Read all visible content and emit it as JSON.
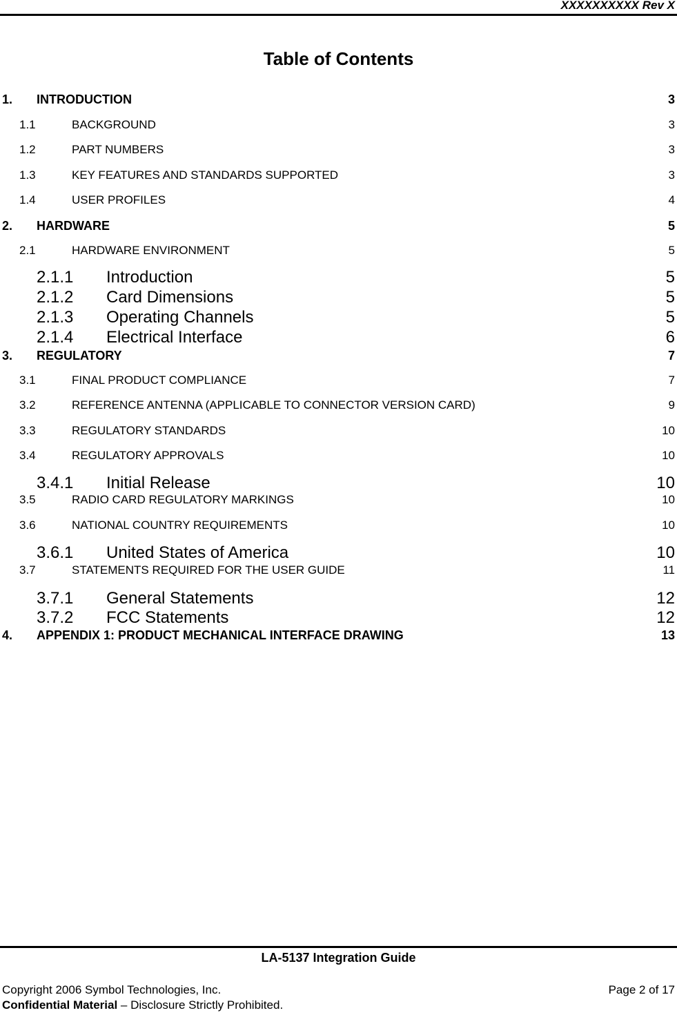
{
  "header": {
    "doc_id": "XXXXXXXXXX Rev X"
  },
  "title": "Table of Contents",
  "toc": [
    {
      "level": 1,
      "num": "1.",
      "label": "INTRODUCTION",
      "page": "3"
    },
    {
      "level": 2,
      "num": "1.1",
      "label": "BACKGROUND",
      "page": "3"
    },
    {
      "level": 2,
      "num": "1.2",
      "label": "PART NUMBERS",
      "page": "3"
    },
    {
      "level": 2,
      "num": "1.3",
      "label": "KEY FEATURES AND STANDARDS SUPPORTED",
      "page": "3"
    },
    {
      "level": 2,
      "num": "1.4",
      "label": "USER PROFILES",
      "page": "4"
    },
    {
      "level": 1,
      "num": "2.",
      "label": "HARDWARE",
      "page": "5"
    },
    {
      "level": 2,
      "num": "2.1",
      "label": "HARDWARE ENVIRONMENT",
      "page": "5"
    },
    {
      "level": 3,
      "num": "2.1.1",
      "label": "Introduction",
      "page": "5"
    },
    {
      "level": 3,
      "num": "2.1.2",
      "label": "Card Dimensions",
      "page": "5"
    },
    {
      "level": 3,
      "num": "2.1.3",
      "label": "Operating Channels",
      "page": "5"
    },
    {
      "level": 3,
      "num": "2.1.4",
      "label": "Electrical Interface",
      "page": "6"
    },
    {
      "level": 1,
      "num": "3.",
      "label": "REGULATORY",
      "page": "7"
    },
    {
      "level": 2,
      "num": "3.1",
      "label": "FINAL PRODUCT COMPLIANCE",
      "page": "7"
    },
    {
      "level": 2,
      "num": "3.2",
      "label": "REFERENCE ANTENNA (APPLICABLE TO CONNECTOR VERSION CARD)",
      "page": "9"
    },
    {
      "level": 2,
      "num": "3.3",
      "label": "REGULATORY STANDARDS",
      "page": "10"
    },
    {
      "level": 2,
      "num": "3.4",
      "label": "REGULATORY APPROVALS",
      "page": "10"
    },
    {
      "level": 3,
      "num": "3.4.1",
      "label": "Initial Release",
      "page": "10"
    },
    {
      "level": 2,
      "num": "3.5",
      "label": "RADIO CARD REGULATORY MARKINGS",
      "page": "10"
    },
    {
      "level": 2,
      "num": "3.6",
      "label": "NATIONAL COUNTRY REQUIREMENTS",
      "page": "10"
    },
    {
      "level": 3,
      "num": "3.6.1",
      "label": "United States of America",
      "page": "10"
    },
    {
      "level": 2,
      "num": "3.7",
      "label": "STATEMENTS REQUIRED FOR THE USER GUIDE",
      "page": "11"
    },
    {
      "level": 3,
      "num": "3.7.1",
      "label": "General Statements",
      "page": "12"
    },
    {
      "level": 3,
      "num": "3.7.2",
      "label": "FCC Statements",
      "page": "12"
    },
    {
      "level": 1,
      "num": "4.",
      "label": "APPENDIX 1: PRODUCT MECHANICAL INTERFACE DRAWING",
      "page": "13"
    }
  ],
  "footer": {
    "title": "LA-5137 Integration Guide",
    "copyright": "Copyright 2006 Symbol Technologies, Inc.",
    "page": "Page 2 of 17",
    "confidential_bold": "Confidential Material",
    "confidential_rest": " – Disclosure Strictly Prohibited."
  }
}
